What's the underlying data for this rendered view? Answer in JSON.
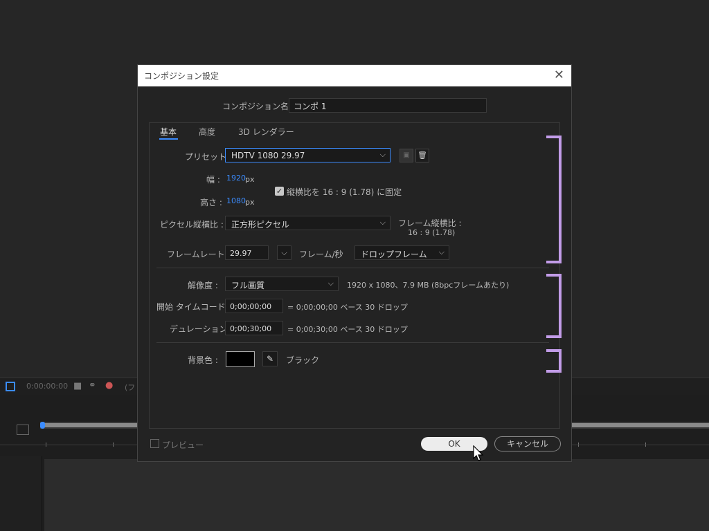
{
  "background": {
    "timecode": "0:00:00:00",
    "layer_label_partial": "(フ"
  },
  "dialog": {
    "title": "コンポジション設定",
    "comp_name_label": "コンポジション名 :",
    "comp_name_value": "コンポ 1",
    "tabs": [
      {
        "label": "基本",
        "active": true
      },
      {
        "label": "高度",
        "active": false
      },
      {
        "label": "3D レンダラー",
        "active": false
      }
    ],
    "basic": {
      "preset_label": "プリセット :",
      "preset_value": "HDTV 1080 29.97",
      "width_label": "幅 :",
      "width_value": "1920",
      "width_unit": "px",
      "height_label": "高さ :",
      "height_value": "1080",
      "height_unit": "px",
      "lock_aspect_label": "縦横比を 16 : 9 (1.78) に固定",
      "lock_aspect_checked": true,
      "pixel_aspect_label": "ピクセル縦横比 :",
      "pixel_aspect_value": "正方形ピクセル",
      "frame_aspect_label": "フレーム縦横比 :",
      "frame_aspect_value": "16 : 9 (1.78)",
      "frame_rate_label": "フレームレート :",
      "frame_rate_value": "29.97",
      "frame_rate_unit": "フレーム/秒",
      "drop_frame_value": "ドロップフレーム",
      "resolution_label": "解像度 :",
      "resolution_value": "フル画質",
      "resolution_info": "1920 x 1080、7.9 MB (8bpcフレームあたり)",
      "start_tc_label": "開始 タイムコード :",
      "start_tc_value": "0;00;00;00",
      "start_tc_info": "= 0;00;00;00  ベース 30  ドロップ",
      "duration_label": "デュレーション :",
      "duration_value": "0;00;30;00",
      "duration_info": "= 0;00;30;00  ベース 30  ドロップ",
      "bgcolor_label": "背景色 :",
      "bgcolor_name": "ブラック"
    },
    "footer": {
      "preview_label": "プレビュー",
      "ok_label": "OK",
      "cancel_label": "キャンセル"
    },
    "colors": {
      "accent": "#3b8cff",
      "bracket": "#c29ce8",
      "bg_swatch": "#000000"
    }
  }
}
